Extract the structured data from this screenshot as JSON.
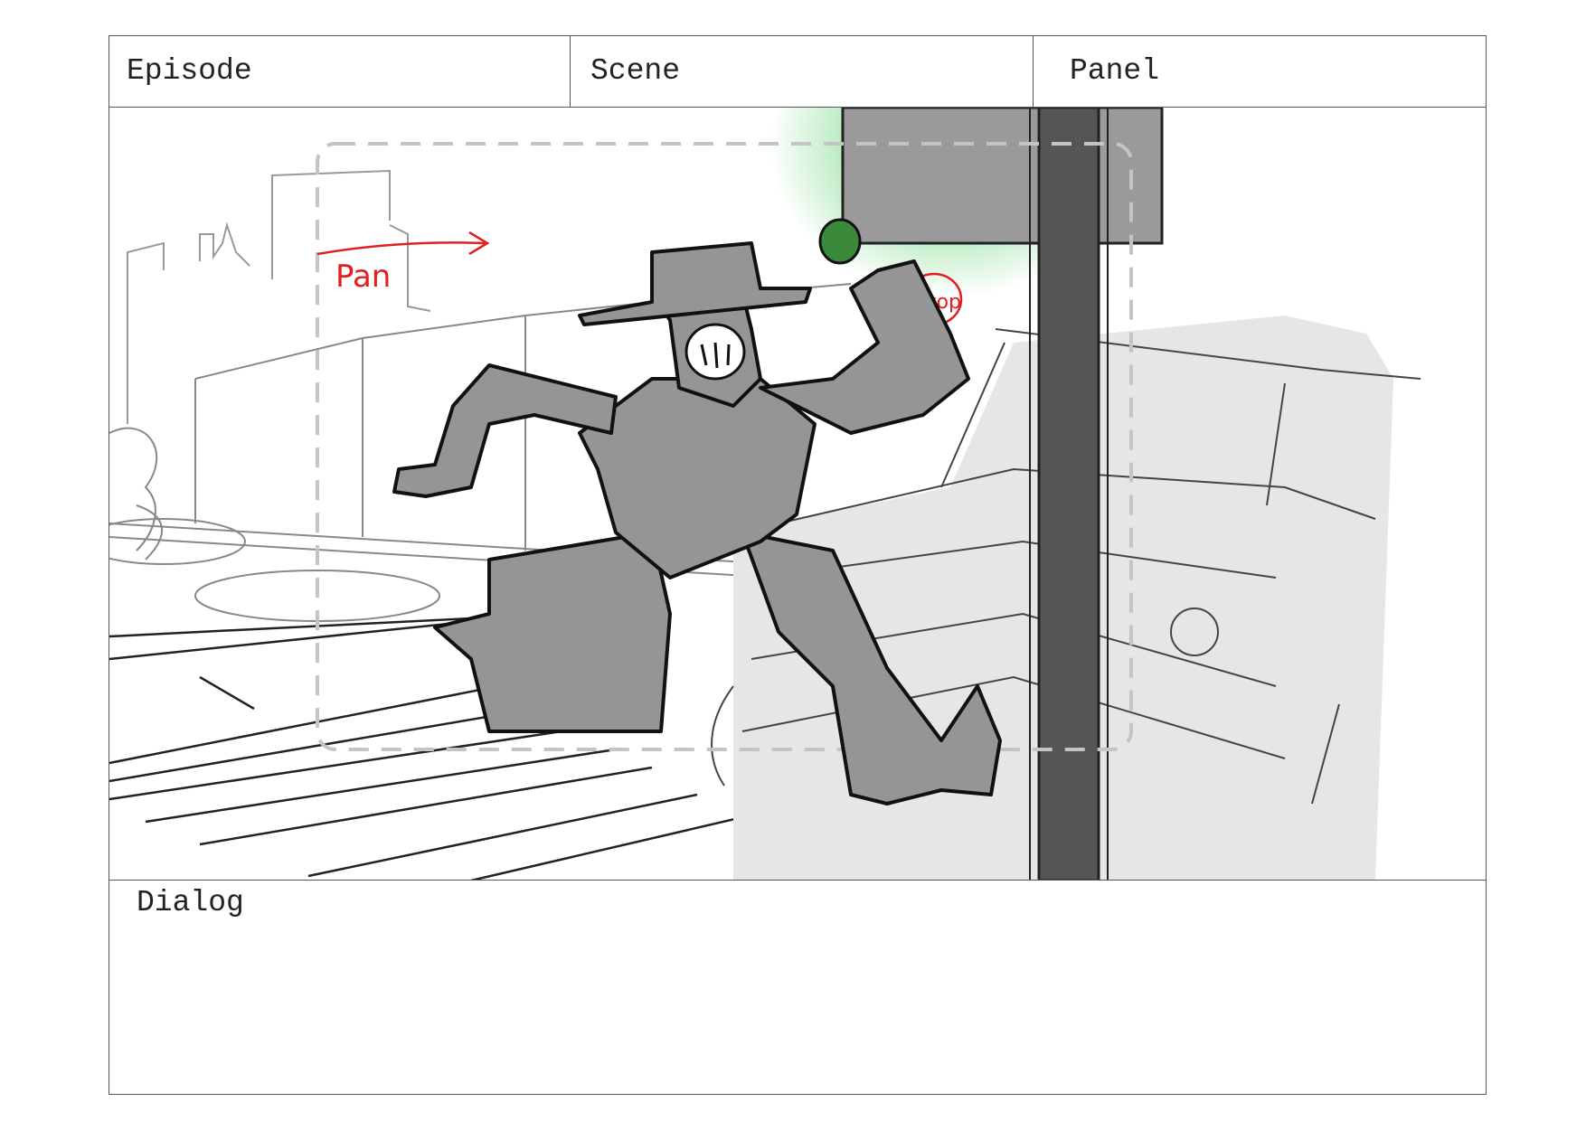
{
  "header": {
    "episode_label": "Episode",
    "scene_label": "Scene",
    "panel_label": "Panel"
  },
  "panel": {
    "pan_note": "Pan",
    "stop_note": "Stop",
    "note_color": "#e02020",
    "signal_color": "#35c44a"
  },
  "dialog": {
    "label": "Dialog"
  }
}
